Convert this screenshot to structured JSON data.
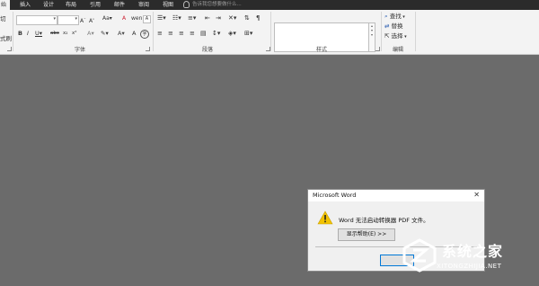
{
  "tabs": [
    {
      "label": "始",
      "selected": true
    },
    {
      "label": "插入"
    },
    {
      "label": "设计"
    },
    {
      "label": "布局"
    },
    {
      "label": "引用"
    },
    {
      "label": "邮件"
    },
    {
      "label": "审阅"
    },
    {
      "label": "视图"
    }
  ],
  "tell_me": {
    "placeholder": "告诉我您想要做什么..."
  },
  "ribbon": {
    "clipboard": {
      "cut_label": "切",
      "format_painter_label": "式刷"
    },
    "groups": {
      "font": "字体",
      "paragraph": "段落",
      "styles": "样式",
      "editing": "编辑"
    },
    "editing": {
      "find": "查找",
      "replace": "替换",
      "select": "选择"
    }
  },
  "dialog": {
    "title": "Microsoft Word",
    "message": "Word 无法启动转换器 PDF 文件。",
    "help_button": "显示帮助(E) >>"
  },
  "watermark": {
    "brand": "系统之家",
    "url": "XITONGZHIJIA.NET"
  },
  "colors": {
    "workspace": "#6b6b6b",
    "tabbar": "#2b2b2b",
    "ribbon": "#f3f3f3",
    "warning": "#f2c200"
  }
}
